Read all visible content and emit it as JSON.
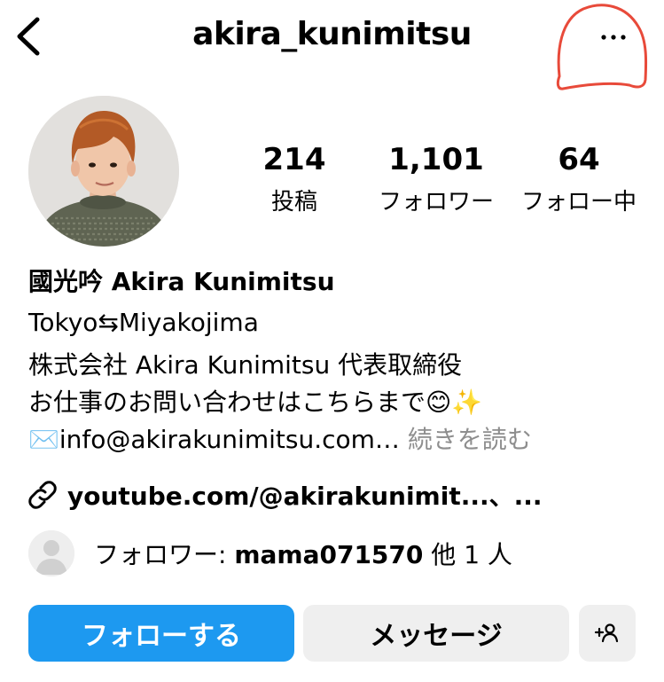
{
  "header": {
    "username": "akira_kunimitsu"
  },
  "stats": {
    "posts": {
      "value": "214",
      "label": "投稿"
    },
    "followers": {
      "value": "1,101",
      "label": "フォロワー"
    },
    "following": {
      "value": "64",
      "label": "フォロー中"
    }
  },
  "bio": {
    "name": "國光吟 Akira Kunimitsu",
    "line1": "Tokyo⇆Miyakojima",
    "line2": "株式会社 Akira Kunimitsu 代表取締役",
    "line3": "お仕事のお問い合わせはこちらまで😊✨",
    "line4": "✉️info@akirakunimitsu.com…",
    "more_label": "続きを読む"
  },
  "link": {
    "text": "youtube.com/@akirakunimit...、..."
  },
  "followed_by": {
    "prefix": "フォロワー: ",
    "user": "mama071570",
    "suffix": " 他 1 人"
  },
  "buttons": {
    "follow": "フォローする",
    "message": "メッセージ"
  },
  "icons": {
    "back": "chevron-left-icon",
    "more": "more-horizontal-icon",
    "link": "link-icon",
    "add_person": "add-person-icon"
  },
  "colors": {
    "accent": "#1d99f0",
    "secondary_button": "#efefef",
    "muted_text": "#8e8e8e",
    "annotation": "#e84a3a"
  }
}
